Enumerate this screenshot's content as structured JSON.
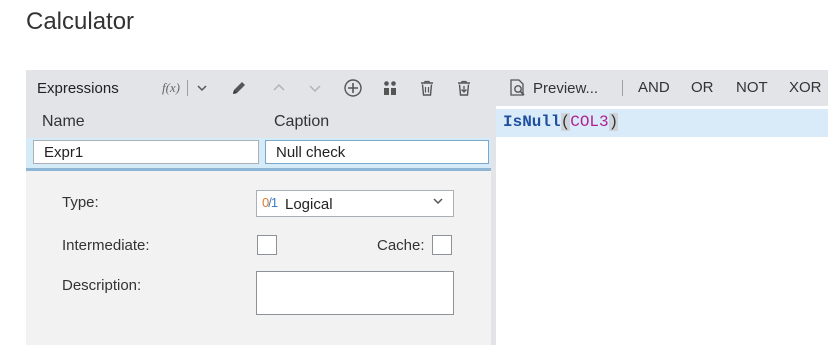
{
  "page": {
    "title": "Calculator"
  },
  "expressions": {
    "title": "Expressions",
    "fx_label": "f(x)",
    "columns": {
      "name": "Name",
      "caption": "Caption"
    },
    "row": {
      "name": "Expr1",
      "caption": "Null check"
    }
  },
  "form": {
    "type_label": "Type:",
    "type_icon_zero": "0",
    "type_icon_slash": "/",
    "type_icon_one": "1",
    "type_value": "Logical",
    "intermediate_label": "Intermediate:",
    "cache_label": "Cache:",
    "description_label": "Description:",
    "description_value": ""
  },
  "editor_toolbar": {
    "preview_label": "Preview...",
    "operators": [
      "AND",
      "OR",
      "NOT",
      "XOR"
    ]
  },
  "editor": {
    "function": "IsNull",
    "open_paren": "(",
    "argument": "COL3",
    "close_paren": ")"
  },
  "colors": {
    "toolbar_bg": "#e2e4e8",
    "selection_bg": "#d6ebf8",
    "function_color": "#1f4fa0",
    "column_color": "#b02090",
    "logical_zero": "#e07b2b",
    "logical_one": "#3b7cc4"
  },
  "icons": [
    "fx-icon",
    "chevron-down-icon",
    "pencil-icon",
    "arrow-up-icon",
    "arrow-down-icon",
    "add-circle-icon",
    "people-icon",
    "trash-icon",
    "trash-download-icon",
    "preview-icon"
  ]
}
